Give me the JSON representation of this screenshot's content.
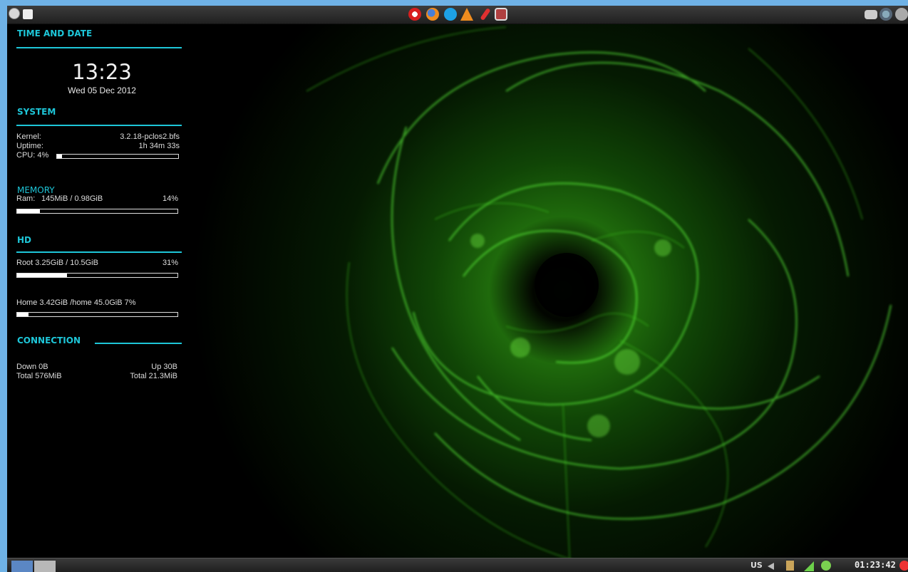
{
  "top_panel": {
    "left_icons": [
      "pclinuxos-menu-icon",
      "show-desktop-icon"
    ],
    "launchers": [
      "opera-icon",
      "firefox-icon",
      "skype-icon",
      "vlc-icon",
      "text-editor-icon",
      "package-manager-icon"
    ],
    "right_icons": [
      "monitor-icon",
      "network-globe-icon",
      "settings-icon"
    ]
  },
  "conky": {
    "time_date": {
      "heading": "TIME AND DATE",
      "time": "13:23",
      "date": "Wed 05 Dec 2012"
    },
    "system": {
      "heading": "SYSTEM",
      "kernel_label": "Kernel:",
      "kernel_value": "3.2.18-pclos2.bfs",
      "uptime_label": "Uptime:",
      "uptime_value": "1h 34m 33s",
      "cpu_label": "CPU: 4%",
      "cpu_percent": 4
    },
    "memory": {
      "heading": "MEMORY",
      "ram_label": "Ram:",
      "ram_value": "145MiB / 0.98GiB",
      "ram_percent_label": "14%",
      "ram_percent": 14
    },
    "hd": {
      "heading": "HD",
      "root_text": "Root  3.25GiB / 10.5GiB",
      "root_percent_label": "31%",
      "root_percent": 31,
      "home_text": "Home  3.42GiB /home 45.0GiB  7%",
      "home_percent": 7
    },
    "connection": {
      "heading": "CONNECTION",
      "down": "Down 0B",
      "up": "Up 30B",
      "total_down": "Total 576MiB",
      "total_up": "Total 21.3MiB"
    }
  },
  "bottom_panel": {
    "keyboard_layout": "US",
    "clock": "01:23:42",
    "tray_icons": [
      "volume-icon",
      "clipboard-icon",
      "network-signal-icon",
      "update-check-icon",
      "power-icon"
    ]
  },
  "colors": {
    "accent": "#1ec6d8",
    "text": "#dddddd",
    "border": "#6fb2e6",
    "wallpaper_glow": "#3fdc1e"
  }
}
